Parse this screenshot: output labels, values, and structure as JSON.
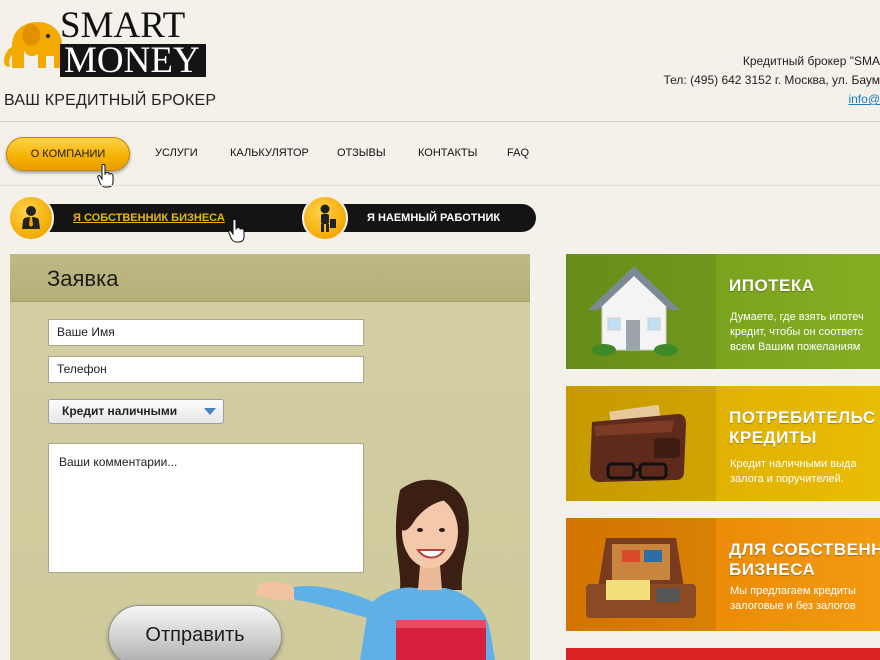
{
  "brand": {
    "logo_top": "SMART",
    "logo_bottom": "MONEY",
    "tagline": "ВАШ КРЕДИТНЫЙ БРОКЕР"
  },
  "contact": {
    "line1": "Кредитный брокер \"SMA",
    "line2": "Тел: (495) 642 3152 г. Москва, ул. Баум",
    "email": "info@"
  },
  "nav": {
    "items": [
      "О КОМПАНИИ",
      "УСЛУГИ",
      "КАЛЬКУЛЯТОР",
      "ОТЗЫВЫ",
      "КОНТАКТЫ",
      "FAQ"
    ]
  },
  "audience": {
    "business_owner": "Я СОБСТВЕННИК БИЗНЕСА",
    "employee": "Я НАЕМНЫЙ РАБОТНИК"
  },
  "form": {
    "title": "Заявка",
    "name_placeholder": "Ваше Имя",
    "phone_placeholder": "Телефон",
    "select_value": "Кредит наличными",
    "comment_placeholder": "Ваши комментарии...",
    "submit_label": "Отправить"
  },
  "cards": [
    {
      "title_1": "ИПОТЕКА",
      "title_2": "",
      "desc": [
        "Думаете, где взять ипотеч",
        "кредит, чтобы он соответс",
        "всем Вашим пожеланиям"
      ],
      "color": "#7ba31e"
    },
    {
      "title_1": "ПОТРЕБИТЕЛЬС",
      "title_2": "КРЕДИТЫ",
      "desc": [
        "Кредит наличными выда",
        "залога и поручителей."
      ],
      "color": "#e2b204"
    },
    {
      "title_1": "ДЛЯ СОБСТВЕНН",
      "title_2": "БИЗНЕСА",
      "desc": [
        "Мы предлагаем кредиты",
        "залоговые и без залогов"
      ],
      "color": "#ee8c08"
    }
  ],
  "colors": {
    "accent": "#f5b000",
    "dark_bar": "#141414",
    "form_bg": "#d1cca0"
  }
}
